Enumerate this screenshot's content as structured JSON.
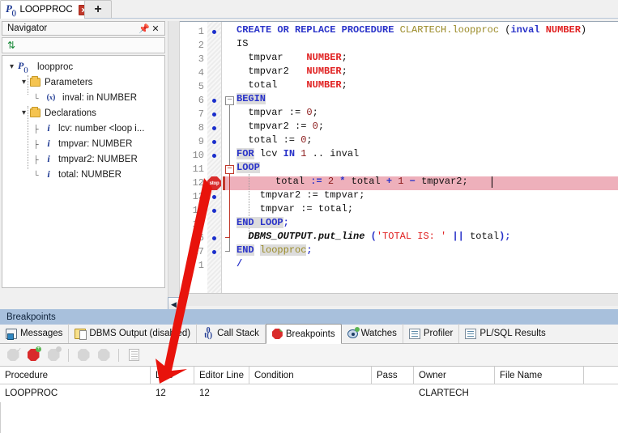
{
  "window": {
    "doc_tab": {
      "label": "LOOPPROC",
      "icon": "procedure-icon",
      "close": "x"
    },
    "new_tab": "+"
  },
  "navigator": {
    "title": "Navigator",
    "pin": "pin-icon",
    "close": "close-icon",
    "refresh": "refresh-icon",
    "tree": [
      {
        "label": "loopproc",
        "icon": "procedure-icon",
        "depth": 0,
        "expander": "expanded"
      },
      {
        "label": "Parameters",
        "icon": "folder-icon",
        "depth": 1,
        "expander": "expanded"
      },
      {
        "label": "inval: in NUMBER",
        "icon": "parameter-icon",
        "depth": 2,
        "expander": ""
      },
      {
        "label": "Declarations",
        "icon": "folder-icon",
        "depth": 1,
        "expander": "expanded"
      },
      {
        "label": "lcv: number <loop i...",
        "icon": "variable-icon",
        "depth": 2,
        "expander": ""
      },
      {
        "label": "tmpvar: NUMBER",
        "icon": "variable-icon",
        "depth": 2,
        "expander": ""
      },
      {
        "label": "tmpvar2: NUMBER",
        "icon": "variable-icon",
        "depth": 2,
        "expander": ""
      },
      {
        "label": "total: NUMBER",
        "icon": "variable-icon",
        "depth": 2,
        "expander": ""
      }
    ]
  },
  "editor": {
    "breakpoint_line": 12,
    "highlight_line": 12,
    "lines": [
      {
        "n": "1",
        "dot": true,
        "indent": 0
      },
      {
        "n": "2",
        "dot": false,
        "indent": 0
      },
      {
        "n": "3",
        "dot": false,
        "indent": 0
      },
      {
        "n": "4",
        "dot": false,
        "indent": 0
      },
      {
        "n": "5",
        "dot": false,
        "indent": 0
      },
      {
        "n": "6",
        "dot": true,
        "indent": 0
      },
      {
        "n": "7",
        "dot": true,
        "indent": 0
      },
      {
        "n": "8",
        "dot": true,
        "indent": 0
      },
      {
        "n": "9",
        "dot": true,
        "indent": 0
      },
      {
        "n": "10",
        "dot": true,
        "indent": 0
      },
      {
        "n": "11",
        "dot": false,
        "indent": 0
      },
      {
        "n": "12",
        "dot": false,
        "indent": 0
      },
      {
        "n": "13",
        "dot": true,
        "indent": 0
      },
      {
        "n": "14",
        "dot": true,
        "indent": 0
      },
      {
        "n": "15",
        "dot": false,
        "indent": 0
      },
      {
        "n": "16",
        "dot": true,
        "indent": 0
      },
      {
        "n": "17",
        "dot": true,
        "indent": 0
      },
      {
        "n": "1",
        "dot": false,
        "indent": 0
      }
    ],
    "source": [
      "CREATE OR REPLACE PROCEDURE CLARTECH.loopproc (inval NUMBER)",
      "IS",
      "  tmpvar    NUMBER;",
      "  tmpvar2   NUMBER;",
      "  total     NUMBER;",
      "BEGIN",
      "  tmpvar := 0;",
      "  tmpvar2 := 0;",
      "  total := 0;",
      "  FOR lcv IN 1 .. inval",
      "  LOOP",
      "    total := 2 * total + 1 - tmpvar2;",
      "    tmpvar2 := tmpvar;",
      "    tmpvar := total;",
      "  END LOOP;",
      "  DBMS_OUTPUT.put_line ('TOTAL IS: ' || total);",
      "END loopproc;",
      "/"
    ],
    "breakpoint_icon_label": "stop"
  },
  "dock": {
    "title": "Breakpoints",
    "tabs": [
      {
        "label": "Messages",
        "icon": "messages-icon",
        "active": false
      },
      {
        "label": "DBMS Output (disabled)",
        "icon": "dbms-output-icon",
        "active": false
      },
      {
        "label": "Call Stack",
        "icon": "call-stack-icon",
        "active": false
      },
      {
        "label": "Breakpoints",
        "icon": "breakpoint-icon",
        "active": true
      },
      {
        "label": "Watches",
        "icon": "watches-icon",
        "active": false
      },
      {
        "label": "Profiler",
        "icon": "profiler-icon",
        "active": false
      },
      {
        "label": "PL/SQL Results",
        "icon": "results-icon",
        "active": false
      }
    ],
    "toolbar": [
      {
        "name": "toggle-breakpoint-button",
        "state": "disabled"
      },
      {
        "name": "add-breakpoint-button",
        "state": "enabled"
      },
      {
        "name": "remove-breakpoint-button",
        "state": "disabled"
      },
      {
        "name": "enable-breakpoint-button",
        "state": "disabled"
      },
      {
        "name": "disable-breakpoint-button",
        "state": "disabled"
      },
      {
        "name": "breakpoint-properties-button",
        "state": "disabled"
      }
    ]
  },
  "breakpoints_table": {
    "columns": [
      "Procedure",
      "Line",
      "Editor Line",
      "Condition",
      "Pass",
      "Owner",
      "File Name"
    ],
    "rows": [
      {
        "Procedure": "LOOPPROC",
        "Line": "12",
        "Editor Line": "12",
        "Condition": "",
        "Pass": "",
        "Owner": "CLARTECH",
        "File Name": ""
      }
    ]
  },
  "annotation": {
    "arrow_color": "#e8130c",
    "from": "editor-breakpoint-marker",
    "to": "breakpoints-table-line-cell"
  }
}
